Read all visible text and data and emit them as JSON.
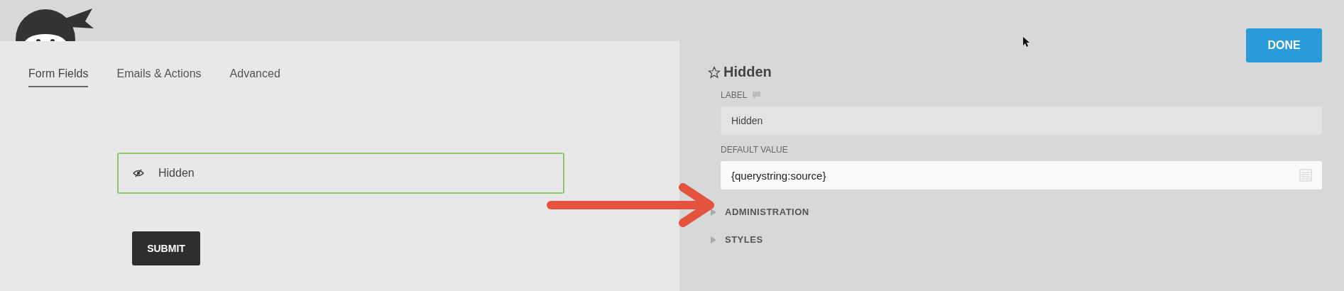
{
  "tabs": [
    {
      "label": "Form Fields",
      "selected": true
    },
    {
      "label": "Emails & Actions",
      "selected": false
    },
    {
      "label": "Advanced",
      "selected": false
    }
  ],
  "form_field": {
    "label": "Hidden"
  },
  "submit_button": "SUBMIT",
  "done_button": "DONE",
  "settings": {
    "title": "Hidden",
    "fields": [
      {
        "kind": "text",
        "label": "LABEL",
        "value": "Hidden",
        "focused": false
      },
      {
        "kind": "merge-tag",
        "label": "DEFAULT VALUE",
        "value": "{querystring:source}",
        "focused": true
      }
    ],
    "sections": [
      {
        "label": "ADMINISTRATION",
        "expanded": false
      },
      {
        "label": "STYLES",
        "expanded": false
      }
    ]
  }
}
